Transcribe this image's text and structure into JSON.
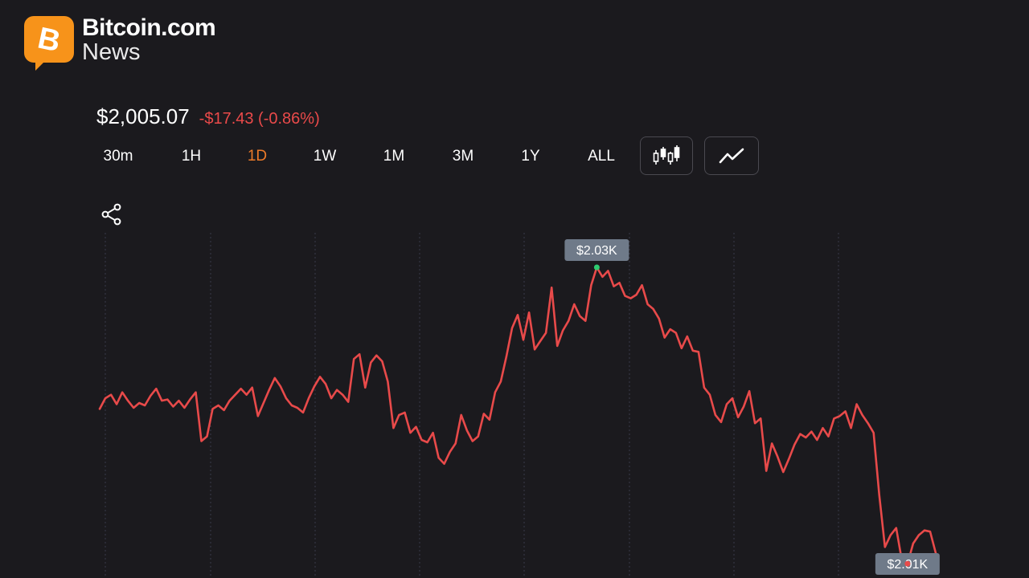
{
  "brand": {
    "title": "Bitcoin.com",
    "subtitle": "News",
    "logo_glyph": "B",
    "logo_color": "#f7931a"
  },
  "price": {
    "current": "$2,005.07",
    "change": "-$17.43 (-0.86%)",
    "change_color": "#ea4a4a"
  },
  "tabs": [
    {
      "label": "30m",
      "active": false
    },
    {
      "label": "1H",
      "active": false
    },
    {
      "label": "1D",
      "active": true
    },
    {
      "label": "1W",
      "active": false
    },
    {
      "label": "1M",
      "active": false
    },
    {
      "label": "3M",
      "active": false
    },
    {
      "label": "1Y",
      "active": false
    },
    {
      "label": "ALL",
      "active": false
    }
  ],
  "accent_color": "#ee7b29",
  "icons": {
    "candlestick": "candlestick-chart-icon",
    "line": "line-chart-icon",
    "share": "share-icon"
  },
  "chart_data": {
    "type": "line",
    "line_color": "#e84a4a",
    "high_label": "$2.03K",
    "low_label": "$2.01K",
    "high_marker_color": "#2ecc71",
    "low_marker_color": "#e84a4a",
    "grid": "vertical-dashed",
    "ylim": [
      2003,
      2032
    ],
    "series": [
      {
        "values": [
          2017.2,
          2018.1,
          2018.4,
          2017.6,
          2018.6,
          2017.9,
          2017.3,
          2017.7,
          2017.5,
          2018.3,
          2018.9,
          2017.9,
          2018.0,
          2017.4,
          2017.9,
          2017.3,
          2018.0,
          2018.6,
          2014.5,
          2014.9,
          2017.2,
          2017.5,
          2017.1,
          2017.9,
          2018.4,
          2018.9,
          2018.4,
          2019.0,
          2016.6,
          2017.7,
          2018.8,
          2019.8,
          2019.1,
          2018.1,
          2017.5,
          2017.3,
          2016.9,
          2018.1,
          2019.1,
          2019.9,
          2019.3,
          2018.1,
          2018.8,
          2018.4,
          2017.8,
          2021.4,
          2021.8,
          2019.0,
          2021.1,
          2021.7,
          2021.2,
          2019.5,
          2015.6,
          2016.7,
          2016.9,
          2015.2,
          2015.7,
          2014.6,
          2014.4,
          2015.2,
          2013.1,
          2012.6,
          2013.6,
          2014.3,
          2016.7,
          2015.4,
          2014.5,
          2014.9,
          2016.8,
          2016.3,
          2018.6,
          2019.5,
          2021.6,
          2024.0,
          2025.1,
          2023.0,
          2025.3,
          2022.2,
          2022.9,
          2023.6,
          2027.4,
          2022.5,
          2023.8,
          2024.6,
          2026.0,
          2025.0,
          2024.6,
          2027.6,
          2029.1,
          2028.3,
          2028.8,
          2027.5,
          2027.8,
          2026.7,
          2026.5,
          2026.8,
          2027.6,
          2026.0,
          2025.6,
          2024.8,
          2023.2,
          2023.9,
          2023.6,
          2022.3,
          2023.3,
          2022.1,
          2022.0,
          2019.0,
          2018.4,
          2016.7,
          2016.1,
          2017.6,
          2018.1,
          2016.5,
          2017.4,
          2018.7,
          2016.0,
          2016.4,
          2012.0,
          2014.3,
          2013.2,
          2011.9,
          2013.0,
          2014.2,
          2015.1,
          2014.8,
          2015.3,
          2014.6,
          2015.6,
          2014.9,
          2016.4,
          2016.6,
          2017.0,
          2015.6,
          2017.6,
          2016.7,
          2016.0,
          2015.2,
          2010.0,
          2005.6,
          2006.6,
          2007.2,
          2004.5,
          2004.2,
          2005.9,
          2006.6,
          2007.0,
          2006.9,
          2005.1
        ]
      }
    ]
  }
}
